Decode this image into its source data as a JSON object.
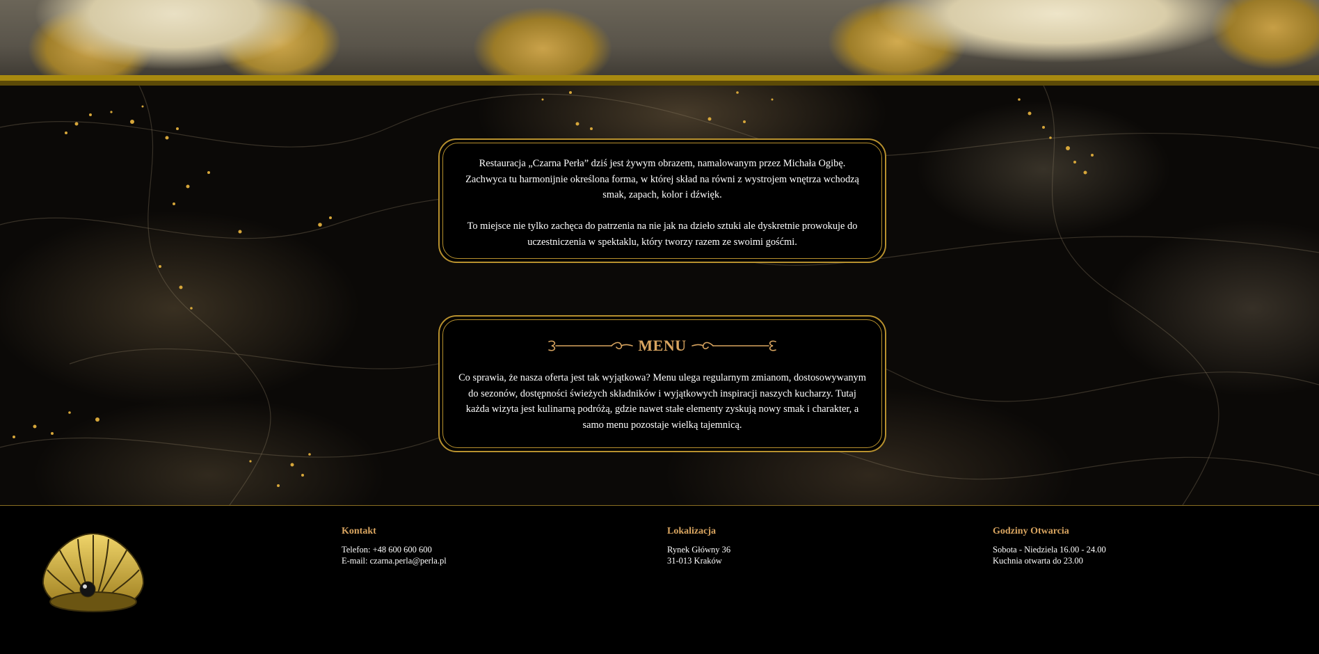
{
  "about": {
    "paragraph_1": "Restauracja „Czarna Perła” dziś jest żywym obrazem, namalowanym przez Michała Ogibę. Zachwyca tu harmonijnie określona forma, w której skład na równi z wystrojem wnętrza wchodzą smak, zapach, kolor i dźwięk.",
    "paragraph_2": "To miejsce nie tylko zachęca do patrzenia na nie jak na dzieło sztuki ale dyskretnie prowokuje do uczestniczenia w spektaklu, który tworzy razem ze swoimi gośćmi."
  },
  "menu": {
    "title": "MENU",
    "text": "Co sprawia, że nasza oferta jest tak wyjątkowa? Menu ulega regularnym zmianom, dostosowywanym do sezonów, dostępności świeżych składników i wyjątkowych inspiracji naszych kucharzy. Tutaj każda wizyta jest kulinarną podróżą, gdzie nawet stałe elementy zyskują nowy smak i charakter, a samo menu pozostaje wielką tajemnicą."
  },
  "footer": {
    "contact": {
      "heading": "Kontakt",
      "phone": "Telefon: +48 600 600 600",
      "email": "E-mail: czarna.perla@perla.pl"
    },
    "location": {
      "heading": "Lokalizacja",
      "street": "Rynek Główny 36",
      "city": "31-013 Kraków"
    },
    "hours": {
      "heading": "Godziny Otwarcia",
      "weekend": "Sobota - Niedziela 16.00 - 24.00",
      "kitchen": "Kuchnia otwarta do 23.00"
    }
  },
  "colors": {
    "gold": "#b8912e",
    "heading_gold": "#d9a560",
    "background": "#000000"
  },
  "icons": {
    "logo": "pearl-shell-icon",
    "ornament_left": "ornament-left-icon",
    "ornament_right": "ornament-right-icon"
  }
}
